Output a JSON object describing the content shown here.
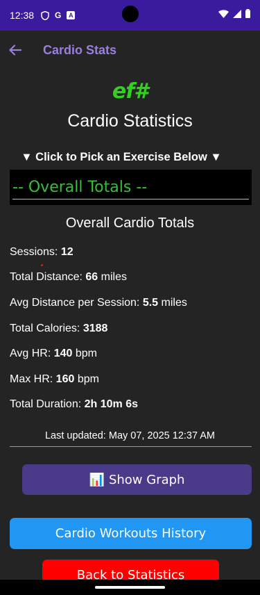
{
  "status_bar": {
    "time": "12:38",
    "icons": [
      "shield-icon",
      "google-icon",
      "font-a-icon",
      "wifi-icon",
      "signal-icon",
      "battery-icon"
    ],
    "google_letter": "G",
    "a_letter": "A",
    "bg_color": "#3a1b9e"
  },
  "app_bar": {
    "title": "Cardio Stats",
    "back_icon": "arrow-left-icon",
    "accent_color": "#9b7fe0"
  },
  "logo": {
    "text": "ef#"
  },
  "page": {
    "title": "Cardio Statistics"
  },
  "picker": {
    "label": "▼ Click to Pick an Exercise Below ▼",
    "selected": "-- Overall Totals --"
  },
  "section": {
    "title": "Overall Cardio Totals"
  },
  "stats": [
    {
      "label": "Sessions: ",
      "value": "12",
      "unit": ""
    },
    {
      "label": "Total Distance: ",
      "value": "66",
      "unit": " miles"
    },
    {
      "label": "Avg Distance per Session: ",
      "value": "5.5",
      "unit": " miles"
    },
    {
      "label": "Total Calories: ",
      "value": "3188",
      "unit": ""
    },
    {
      "label": "Avg HR: ",
      "value": "140",
      "unit": " bpm"
    },
    {
      "label": "Max HR: ",
      "value": "160",
      "unit": " bpm"
    },
    {
      "label": "Total Duration: ",
      "value": "2h 10m 6s",
      "unit": ""
    }
  ],
  "last_updated": "Last updated: May 07, 2025 12:37 AM",
  "buttons": {
    "show_graph": "Show Graph",
    "show_graph_icon": "📊",
    "workouts_history": "Cardio Workouts History",
    "back_to_statistics": "Back to Statistics"
  },
  "colors": {
    "background": "#242424",
    "green": "#35c135",
    "graph_button": "#4a3a8a",
    "history_button": "#2196f3",
    "back_button": "#ff0000"
  }
}
